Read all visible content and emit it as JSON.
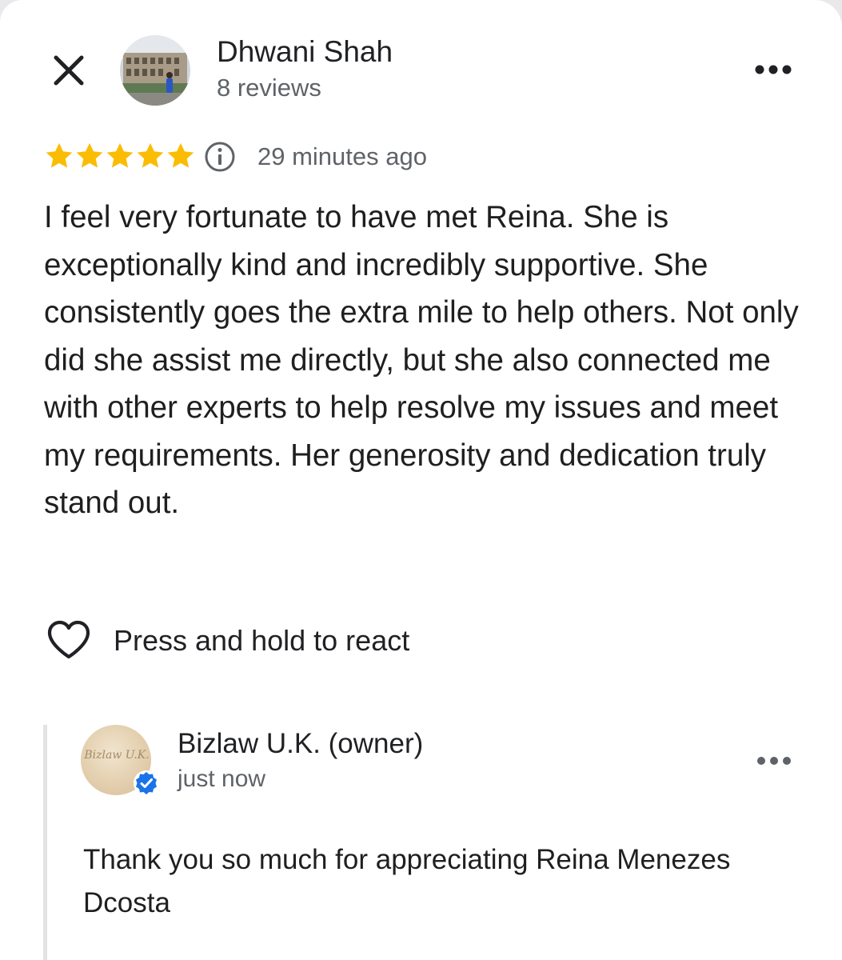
{
  "reviewer": {
    "name": "Dhwani Shah",
    "reviews_count": "8 reviews",
    "avatar_icon": "reviewer-photo-colosseum"
  },
  "review": {
    "rating": 5,
    "max_rating": 5,
    "time": "29 minutes ago",
    "text": "I feel very fortunate to have met Reina. She is exceptionally kind and incredibly supportive. She consistently goes the extra mile to help others. Not only did she assist me directly, but she also connected me with other experts to help resolve my issues and meet my requirements. Her generosity and dedication truly stand out."
  },
  "react": {
    "label": "Press and hold to react",
    "icon": "heart-outline-icon"
  },
  "owner_reply": {
    "name": "Bizlaw U.K. (owner)",
    "time": "just now",
    "logo_text": "Bizlaw U.K.",
    "text": "Thank you so much for appreciating Reina Menezes Dcosta"
  },
  "colors": {
    "star": "#fbbc04",
    "verified": "#1a73e8",
    "secondary_text": "#5f6368",
    "primary_text": "#1f1f1f"
  }
}
